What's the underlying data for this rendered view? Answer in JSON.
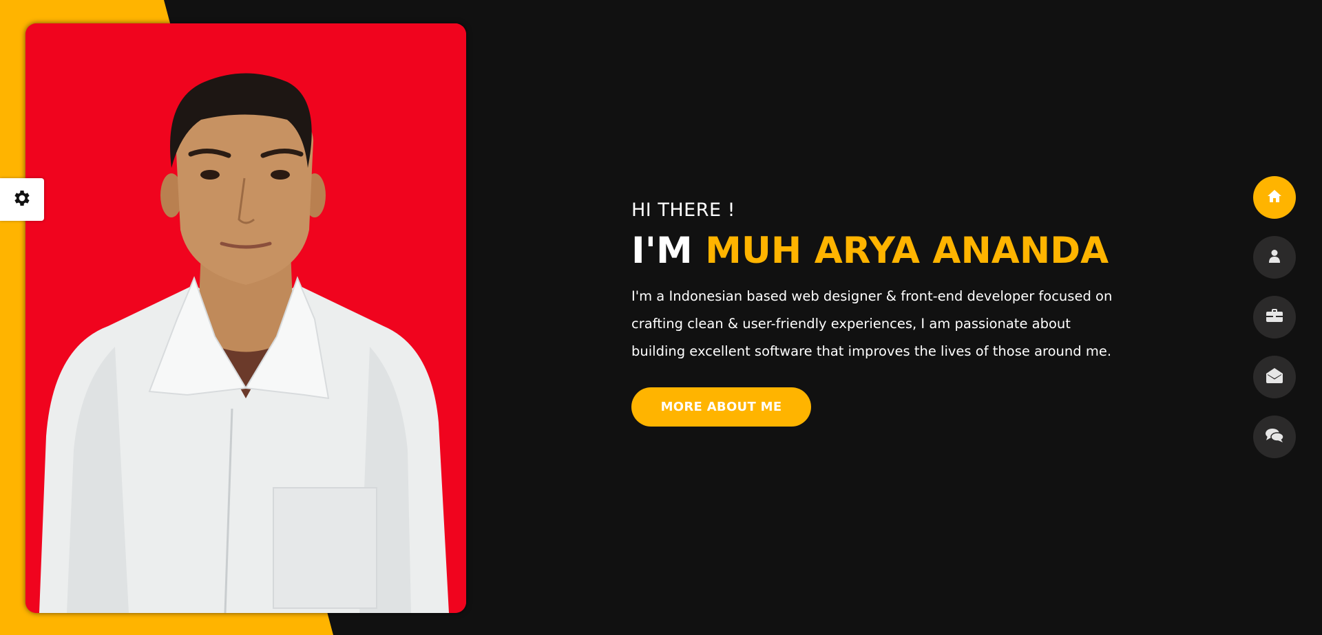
{
  "hero": {
    "greeting": "HI THERE !",
    "headline_prefix": "I'M",
    "name": "MUH ARYA ANANDA",
    "bio": "I'm a Indonesian based web designer & front-end developer focused on crafting clean & user-friendly experiences, I am passionate about building excellent software that improves the lives of those around me.",
    "cta_label": "MORE ABOUT ME"
  },
  "nav": {
    "items": [
      {
        "icon": "home-icon",
        "active": true
      },
      {
        "icon": "user-icon",
        "active": false
      },
      {
        "icon": "briefcase-icon",
        "active": false
      },
      {
        "icon": "envelope-open-icon",
        "active": false
      },
      {
        "icon": "comments-icon",
        "active": false
      }
    ]
  },
  "settings": {
    "icon": "gear-icon"
  },
  "colors": {
    "background": "#111111",
    "accent": "#ffb400",
    "nav_button": "#2b2a2a",
    "portrait_background": "#f0041e"
  }
}
